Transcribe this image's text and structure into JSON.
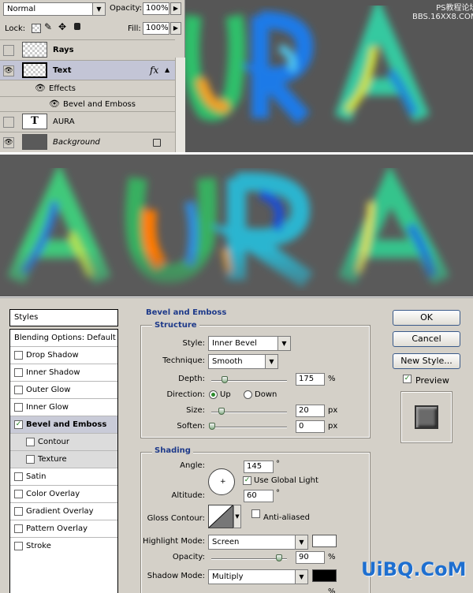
{
  "layers_panel": {
    "blend_mode": "Normal",
    "opacity_label": "Opacity:",
    "opacity_value": "100%",
    "lock_label": "Lock:",
    "fill_label": "Fill:",
    "fill_value": "100%",
    "layers": [
      {
        "name": "Rays"
      },
      {
        "name": "Text",
        "fx": "fx"
      },
      {
        "name": "Effects"
      },
      {
        "name": "Bevel and Emboss"
      },
      {
        "name": "AURA",
        "type_glyph": "T"
      },
      {
        "name": "Background"
      }
    ]
  },
  "watermark_top": {
    "line1": "PS教程论坛",
    "line2": "BBS.16XX8.COM"
  },
  "artwork": {
    "top_text": "URA",
    "main_text": "AURA"
  },
  "dialog": {
    "styles_header": "Styles",
    "style_items": [
      {
        "label": "Blending Options: Default"
      },
      {
        "label": "Drop Shadow"
      },
      {
        "label": "Inner Shadow"
      },
      {
        "label": "Outer Glow"
      },
      {
        "label": "Inner Glow"
      },
      {
        "label": "Bevel and Emboss",
        "checked": true
      },
      {
        "label": "Contour"
      },
      {
        "label": "Texture"
      },
      {
        "label": "Satin"
      },
      {
        "label": "Color Overlay"
      },
      {
        "label": "Gradient Overlay"
      },
      {
        "label": "Pattern Overlay"
      },
      {
        "label": "Stroke"
      }
    ],
    "section_title": "Bevel and Emboss",
    "structure": {
      "title": "Structure",
      "style_label": "Style:",
      "style_value": "Inner Bevel",
      "technique_label": "Technique:",
      "technique_value": "Smooth",
      "depth_label": "Depth:",
      "depth_value": "175",
      "depth_unit": "%",
      "depth_fraction": 0.18,
      "direction_label": "Direction:",
      "direction_up": "Up",
      "direction_down": "Down",
      "size_label": "Size:",
      "size_value": "20",
      "size_unit": "px",
      "size_fraction": 0.14,
      "soften_label": "Soften:",
      "soften_value": "0",
      "soften_unit": "px"
    },
    "shading": {
      "title": "Shading",
      "angle_label": "Angle:",
      "angle_value": "145",
      "degree": "°",
      "global_light_label": "Use Global Light",
      "altitude_label": "Altitude:",
      "altitude_value": "60",
      "gloss_label": "Gloss Contour:",
      "anti_aliased_label": "Anti-aliased",
      "highlight_mode_label": "Highlight Mode:",
      "highlight_mode_value": "Screen",
      "highlight_opacity_label": "Opacity:",
      "highlight_opacity_value": "90",
      "percent": "%",
      "highlight_opacity_fraction": 0.9,
      "shadow_mode_label": "Shadow Mode:",
      "shadow_mode_value": "Multiply",
      "shadow_color": "#000000",
      "highlight_color": "#ffffff"
    },
    "buttons": {
      "ok": "OK",
      "cancel": "Cancel",
      "new_style": "New Style...",
      "preview": "Preview"
    }
  },
  "watermark": {
    "text": "UiBQ.CoM"
  }
}
